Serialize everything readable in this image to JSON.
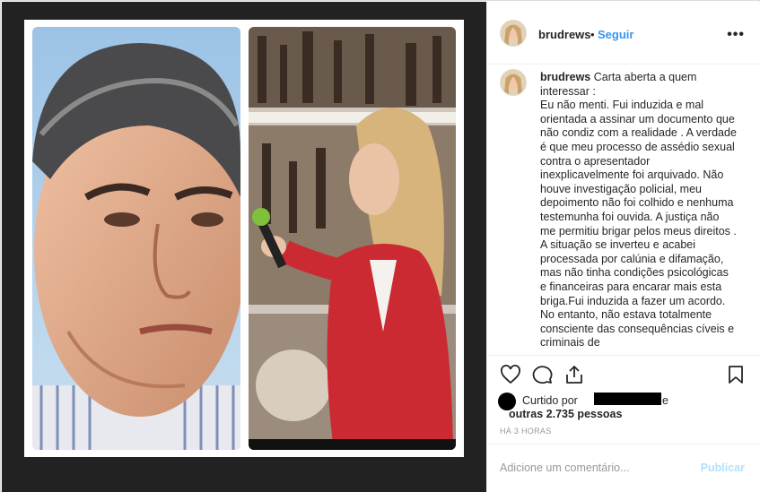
{
  "post": {
    "username": "brudrews",
    "separator": "•",
    "follow_label": "Seguir",
    "more_label": "•••"
  },
  "caption": {
    "username": "brudrews",
    "paragraphs": [
      "Carta aberta a quem interessar :",
      "Eu não menti. Fui induzida e mal orientada a assinar um documento que não condiz com a realidade . A verdade é que meu processo de assédio sexual contra o apresentador inexplicavelmente foi arquivado. Não houve investigação policial, meu depoimento não foi colhido e nenhuma testemunha foi ouvida. A justiça não me permitiu brigar pelos meus direitos . A situação se inverteu e acabei processada por calúnia e difamação, mas não tinha condições psicológicas e financeiras para encarar mais esta briga.Fui induzida a fazer um acordo. No entanto, não estava totalmente consciente das consequências cíveis e criminais de"
    ]
  },
  "actions": {
    "icons": [
      "heart-icon",
      "comment-icon",
      "share-icon",
      "bookmark-icon"
    ]
  },
  "likes": {
    "liked_by_prefix": "Curtido por",
    "liked_by_suffix": "e",
    "others": "outras 2.735 pessoas"
  },
  "timestamp": "HÁ 3 HORAS",
  "comment": {
    "placeholder": "Adicione um comentário...",
    "post_label": "Publicar"
  },
  "colors": {
    "accent": "#3897f0",
    "post_disabled": "#b2dffc",
    "media_background": "#222222"
  }
}
